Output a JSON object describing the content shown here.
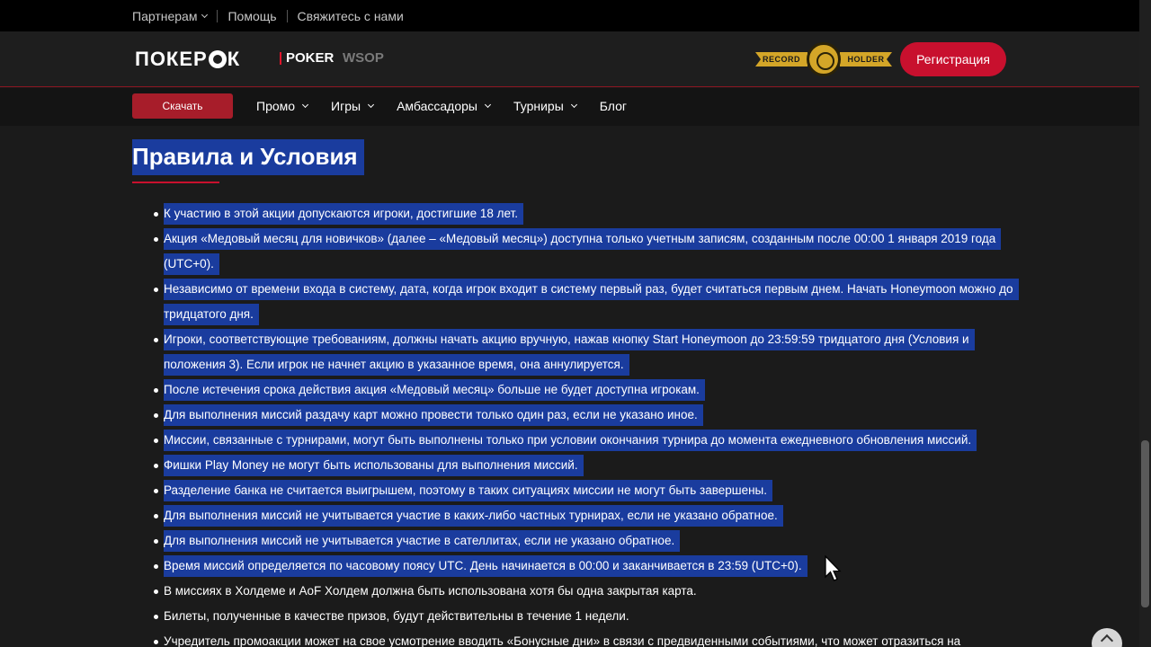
{
  "topbar": {
    "partners": "Партнерам",
    "help": "Помощь",
    "contact": "Свяжитесь с нами"
  },
  "header": {
    "logo_left": "ПОКЕР",
    "logo_right": "К",
    "brand_poker": "POKER",
    "brand_wsop": "WSOP",
    "record_left": "RECORD",
    "record_right": "HOLDER",
    "register_label": "Регистрация"
  },
  "nav": {
    "download_label": "Скачать",
    "items": [
      "Промо",
      "Игры",
      "Амбассадоры",
      "Турниры",
      "Блог"
    ]
  },
  "content": {
    "title": "Правила и Условия",
    "rules": [
      " К участию в этой акции допускаются игроки, достигшие 18 лет.",
      "Акция «Медовый месяц для новичков» (далее – «Медовый месяц») доступна только учетным записям, созданным после 00:00 1 января 2019 года (UTC+0).",
      "Независимо от времени входа в систему, дата, когда игрок входит в систему первый раз, будет считаться первым днем. Начать Honeymoon можно до тридцатого дня.",
      "Игроки, соответствующие требованиям, должны начать акцию вручную, нажав кнопку Start Honeymoon до 23:59:59 тридцатого дня (Условия и положения 3). Если игрок не начнет акцию в указанное время, она аннулируется.",
      "После истечения срока действия акция «Медовый месяц» больше не будет доступна игрокам.",
      " Для выполнения миссий раздачу карт можно провести только один раз, если не указано иное.",
      "Миссии, связанные с турнирами, могут быть выполнены только при условии окончания турнира до момента ежедневного обновления миссий.",
      "Фишки Play Money не могут быть использованы для выполнения миссий.",
      "Разделение банка не считается выигрышем, поэтому в таких ситуациях миссии не могут быть завершены.",
      "Для выполнения миссий не учитывается участие в каких-либо частных турнирах, если не указано обратное.",
      "Для выполнения миссий не учитывается участие в сателлитах, если не указано обратное.",
      "Время миссий определяется по часовому поясу UTC. День начинается в 00:00 и заканчивается в 23:59 (UTC+0).",
      "В миссиях в Холдеме и AoF Холдем должна быть использована хотя бы одна закрытая карта.",
      "Билеты, полученные в качестве призов, будут действительны в течение 1 недели.",
      "Учредитель промоакции может на свое усмотрение вводить «Бонусные дни» в связи с предвиденными событиями, что может отразиться на"
    ],
    "highlighted_count": 12
  },
  "colors": {
    "accent": "#c8102e",
    "selection": "#1a3c9e",
    "background": "#1b1b1b"
  }
}
